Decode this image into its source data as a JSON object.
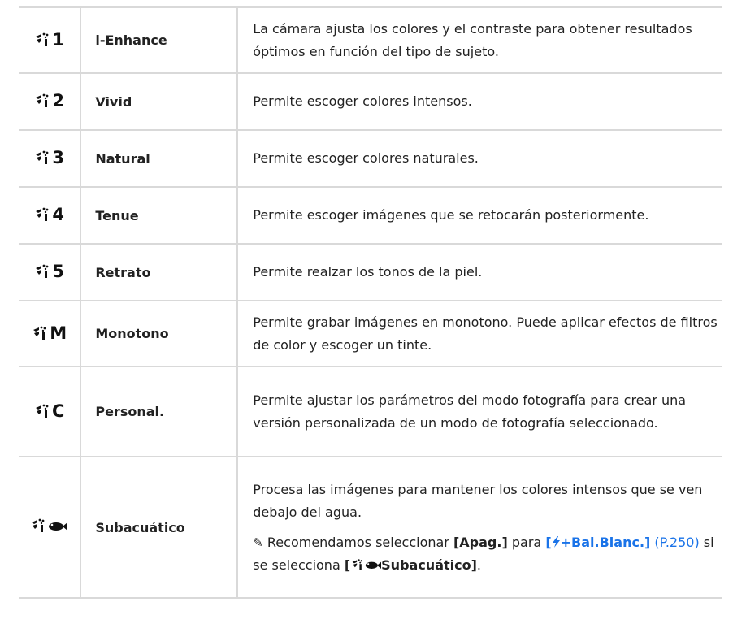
{
  "rows": [
    {
      "mode": "1",
      "name": "i-Enhance",
      "desc": "La cámara ajusta los colores y el contraste para obtener resultados óptimos en función del tipo de sujeto."
    },
    {
      "mode": "2",
      "name": "Vivid",
      "desc": "Permite escoger colores intensos."
    },
    {
      "mode": "3",
      "name": "Natural",
      "desc": "Permite escoger colores naturales."
    },
    {
      "mode": "4",
      "name": "Tenue",
      "desc": "Permite escoger imágenes que se retocarán posteriormente."
    },
    {
      "mode": "5",
      "name": "Retrato",
      "desc": "Permite realzar los tonos de la piel."
    },
    {
      "mode": "M",
      "name": "Monotono",
      "desc": "Permite grabar imágenes en monotono. Puede aplicar efectos de filtros de color y escoger un tinte."
    },
    {
      "mode": "C",
      "name": "Personal.",
      "desc": "Permite ajustar los parámetros del modo fotografía para crear una versión personalizada de un modo de fotografía seleccionado."
    },
    {
      "mode": "",
      "name": "Subacuático",
      "desc": "Procesa las imágenes para mantener los colores intensos que se ven debajo del agua."
    }
  ],
  "note": {
    "pencil_icon": "pencil-icon",
    "part1": "Recomendamos seleccionar",
    "apag": "[Apag.]",
    "para": "para",
    "link_open": "[",
    "link_label": "+Bal.Blanc.]",
    "page_ref": "(P.250)",
    "part2": "si se selecciona",
    "bracket_open": "[",
    "sub_label": "Subacuático]",
    "end": "."
  },
  "colors": {
    "link": "#1a73e8",
    "border": "#d9d9d9"
  }
}
